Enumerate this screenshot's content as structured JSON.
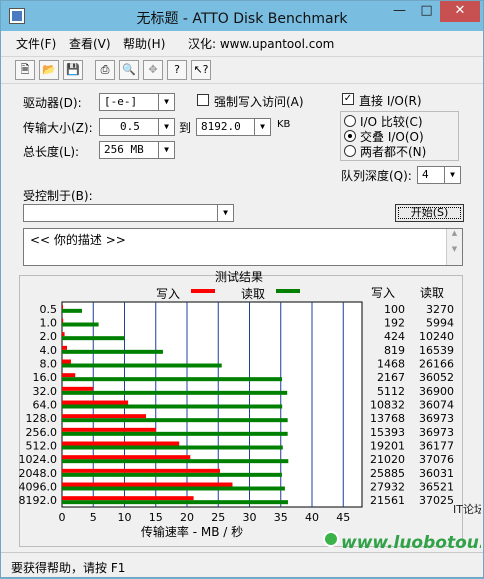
{
  "window": {
    "title": "无标题 - ATTO Disk Benchmark"
  },
  "menu": [
    "文件(F)",
    "查看(V)",
    "帮助(H)",
    "汉化: www.upantool.com"
  ],
  "toolbar": [
    "new-icon",
    "open-icon",
    "save-icon",
    "print-icon",
    "print-preview-icon",
    "move-icon",
    "help-icon",
    "context-help-icon"
  ],
  "controls": {
    "drive_label": "驱动器(D):",
    "drive_value": "[-e-]",
    "force_write_label": "强制写入访问(A)",
    "transfer_label": "传输大小(Z):",
    "transfer_from": "0.5",
    "transfer_to_label": "到",
    "transfer_to": "8192.0",
    "transfer_unit": "KB",
    "length_label": "总长度(L):",
    "length_value": "256 MB",
    "direct_io_label": "直接 I/O(R)",
    "direct_io_checked": true,
    "io_compare_label": "I/O 比较(C)",
    "io_overlap_label": "交叠 I/O(O)",
    "neither_label": "两者都不(N)",
    "selected_io_mode": "交叠 I/O(O)",
    "queue_label": "队列深度(Q):",
    "queue_value": "4",
    "controlled_by_label": "受控制于(B):",
    "controlled_by_value": "",
    "start_label": "开始(S)",
    "description": "<<  你的描述   >>"
  },
  "chart_data": {
    "type": "bar",
    "title": "测试结果",
    "legend": [
      {
        "name": "写入",
        "color": "#ff0000"
      },
      {
        "name": "读取",
        "color": "#008000"
      }
    ],
    "legend_placement": "top",
    "categories": [
      "0.5",
      "1.0",
      "2.0",
      "4.0",
      "8.0",
      "16.0",
      "32.0",
      "64.0",
      "128.0",
      "256.0",
      "512.0",
      "1024.0",
      "2048.0",
      "4096.0",
      "8192.0"
    ],
    "series": [
      {
        "name": "写入",
        "values": [
          100,
          192,
          424,
          819,
          1468,
          2167,
          5112,
          10832,
          13768,
          15393,
          19201,
          21020,
          25885,
          27932,
          21561
        ]
      },
      {
        "name": "读取",
        "values": [
          3270,
          5994,
          10240,
          16539,
          26166,
          36052,
          36900,
          36074,
          36973,
          36973,
          36177,
          37076,
          36031,
          36521,
          37025
        ]
      }
    ],
    "table_headers": [
      "写入",
      "读取"
    ],
    "xlabel": "传输速率 - MB / 秒",
    "xticks": [
      0,
      5,
      10,
      15,
      20,
      25,
      30,
      35,
      40,
      45
    ],
    "xlim": [
      0,
      48
    ],
    "orientation": "horizontal",
    "grid": true
  },
  "statusbar": {
    "text": "要获得帮助，请按 F1"
  },
  "watermark": {
    "text": "www.luobotou.pw",
    "sub": "IT论坛"
  }
}
